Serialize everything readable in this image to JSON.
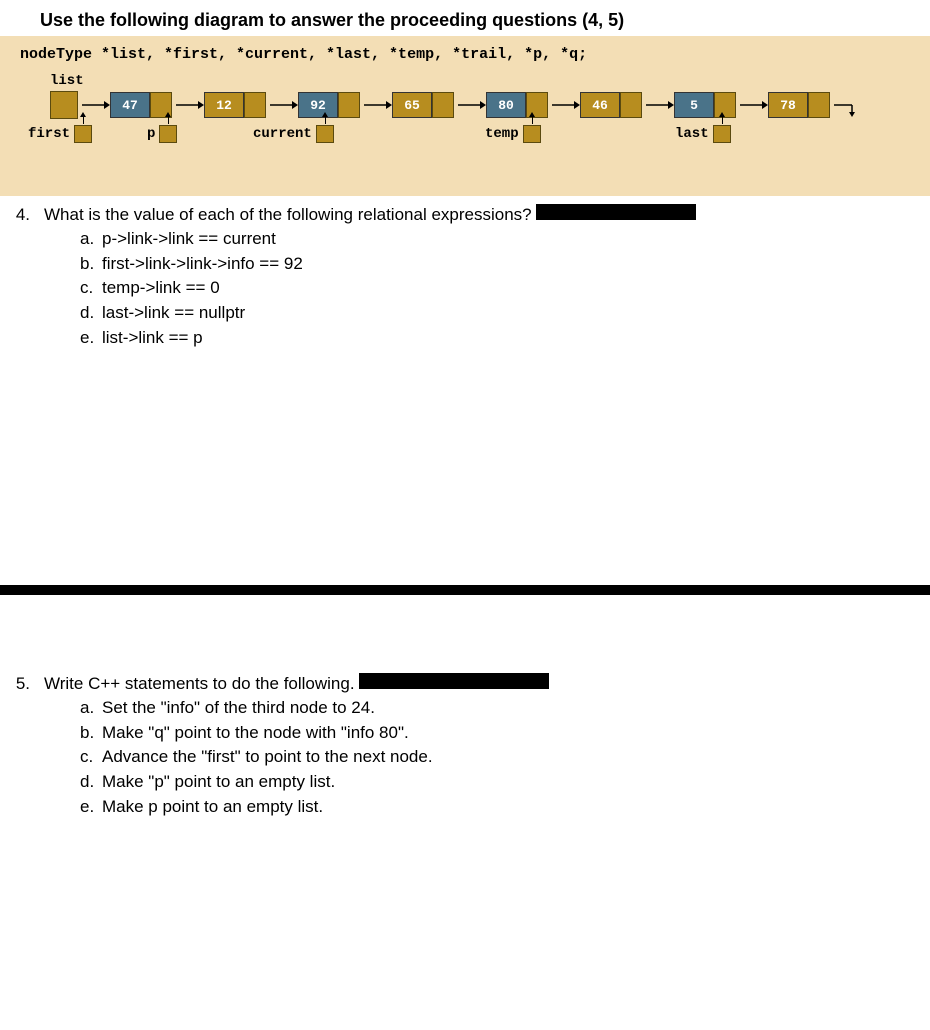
{
  "title": "Use the following diagram to answer the proceeding questions (4, 5)",
  "declaration": "nodeType *list, *first, *current, *last, *temp, *trail, *p, *q;",
  "list_label": "list",
  "nodes": [
    {
      "info": "47"
    },
    {
      "info": "12"
    },
    {
      "info": "92"
    },
    {
      "info": "65"
    },
    {
      "info": "80"
    },
    {
      "info": "46"
    },
    {
      "info": "5"
    },
    {
      "info": "78"
    }
  ],
  "pointers": {
    "first": "first",
    "p": "p",
    "current": "current",
    "temp": "temp",
    "last": "last"
  },
  "q4": {
    "num": "4.",
    "prompt": "What is the value of each of the following relational expressions?",
    "items": [
      {
        "l": "a.",
        "t": "p->link->link == current"
      },
      {
        "l": "b.",
        "t": "first->link->link->info == 92"
      },
      {
        "l": "c.",
        "t": "temp->link == 0"
      },
      {
        "l": "d.",
        "t": "last->link == nullptr"
      },
      {
        "l": "e.",
        "t": "list->link == p"
      }
    ]
  },
  "q5": {
    "num": "5.",
    "prompt": "Write C++ statements to do the following.",
    "items": [
      {
        "l": "a.",
        "t": "Set the \"info\" of the third node to 24."
      },
      {
        "l": "b.",
        "t": "Make \"q\" point to the node with \"info 80\"."
      },
      {
        "l": "c.",
        "t": "Advance the \"first\" to point to the next node."
      },
      {
        "l": "d.",
        "t": "Make \"p\" point to an empty list."
      },
      {
        "l": "e.",
        "t": " Make p point to an empty list."
      }
    ]
  }
}
